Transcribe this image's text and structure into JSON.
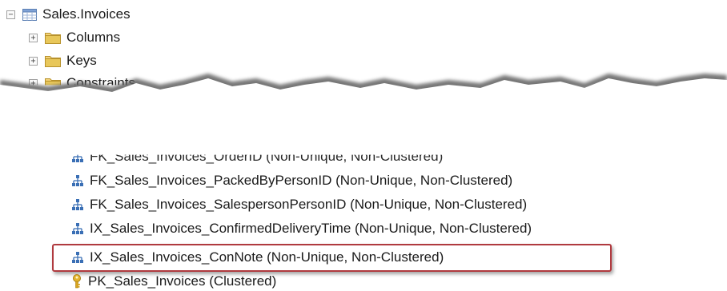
{
  "tree": {
    "table": {
      "label": "Sales.Invoices",
      "expander": "−",
      "icon": "table-icon"
    },
    "folders": [
      {
        "label": "Columns",
        "expander": "+",
        "icon": "folder-icon"
      },
      {
        "label": "Keys",
        "expander": "+",
        "icon": "folder-icon"
      },
      {
        "label": "Constraints",
        "expander": "+",
        "icon": "folder-icon"
      }
    ],
    "indexes": [
      {
        "label": "FK_Sales_Invoices_OrderID (Non-Unique, Non-Clustered)",
        "icon": "index-icon"
      },
      {
        "label": "FK_Sales_Invoices_PackedByPersonID (Non-Unique, Non-Clustered)",
        "icon": "index-icon"
      },
      {
        "label": "FK_Sales_Invoices_SalespersonPersonID (Non-Unique, Non-Clustered)",
        "icon": "index-icon"
      },
      {
        "label": "IX_Sales_Invoices_ConfirmedDeliveryTime (Non-Unique, Non-Clustered)",
        "icon": "index-icon"
      },
      {
        "label": "IX_Sales_Invoices_ConNote (Non-Unique, Non-Clustered)",
        "icon": "index-icon",
        "highlighted": true
      },
      {
        "label": "PK_Sales_Invoices (Clustered)",
        "icon": "key-icon"
      }
    ]
  },
  "colors": {
    "folder": "#e8c75a",
    "index": "#3a6fb5",
    "key": "#d9a520",
    "highlight": "#b03a3f"
  }
}
